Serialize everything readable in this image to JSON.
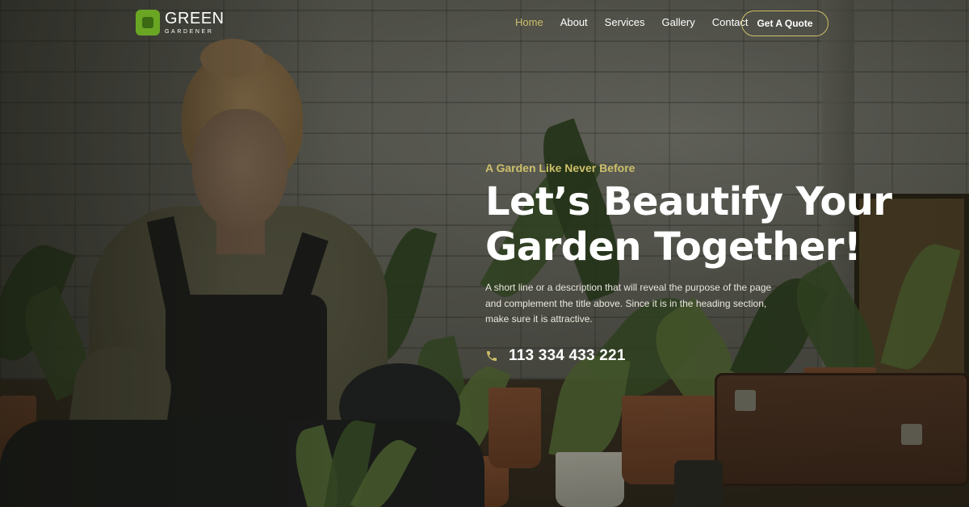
{
  "brand": {
    "name": "GREEN",
    "tagline": "GARDENER",
    "color": "#6aa624"
  },
  "nav": {
    "items": [
      {
        "label": "Home",
        "active": true
      },
      {
        "label": "About",
        "active": false
      },
      {
        "label": "Services",
        "active": false
      },
      {
        "label": "Gallery",
        "active": false
      },
      {
        "label": "Contact",
        "active": false
      }
    ],
    "cta_label": "Get A Quote"
  },
  "hero": {
    "eyebrow": "A Garden Like Never Before",
    "title_line1": "Let’s Beautify Your",
    "title_line2": "Garden Together!",
    "description": "A short line or a description that will reveal the purpose of the page and complement the title above. Since it is in the heading section, make sure it is attractive.",
    "phone_icon": "phone-icon",
    "phone": "113 334 433 221"
  },
  "colors": {
    "accent": "#cdbf6a",
    "text": "#ffffff"
  }
}
